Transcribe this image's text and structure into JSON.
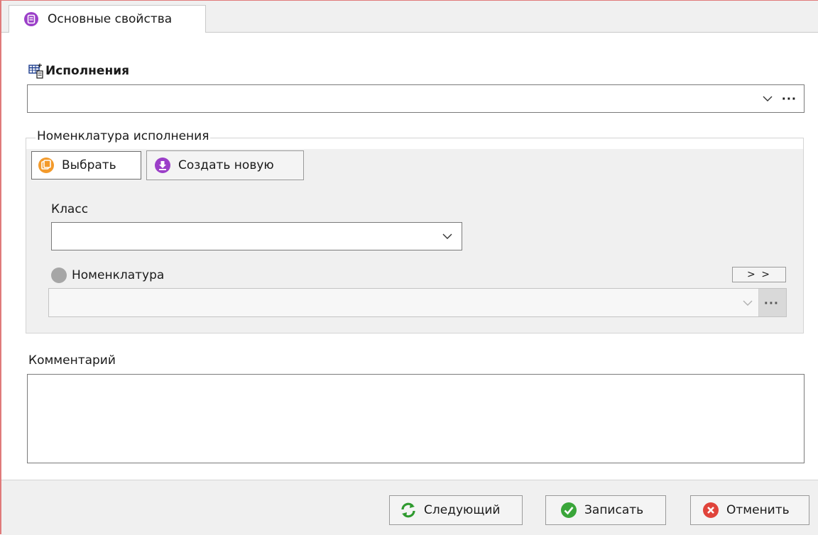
{
  "tab": {
    "label": "Основные свойства",
    "icon": "list-circle-icon",
    "icon_color": "#9b3fc8"
  },
  "executions": {
    "label": "Исполнения",
    "value": "",
    "icon": "table-add-icon",
    "more_label": "···"
  },
  "nomenclature_group": {
    "title": "Номенклатура исполнения",
    "select_button": "Выбрать",
    "create_button": "Создать новую",
    "class_label": "Класс",
    "class_value": "",
    "nomenclature_label": "Номенклатура",
    "nomenclature_value": "",
    "expand_button": "> >",
    "more_label": "···"
  },
  "comment": {
    "label": "Комментарий",
    "value": ""
  },
  "footer": {
    "next_button": "Следующий",
    "save_button": "Записать",
    "cancel_button": "Отменить"
  },
  "colors": {
    "accent_purple": "#9b3fc8",
    "accent_orange": "#f39a2b",
    "ok_green": "#3aa63a",
    "cancel_red": "#e0443b",
    "frame_border": "#e07a7a"
  }
}
